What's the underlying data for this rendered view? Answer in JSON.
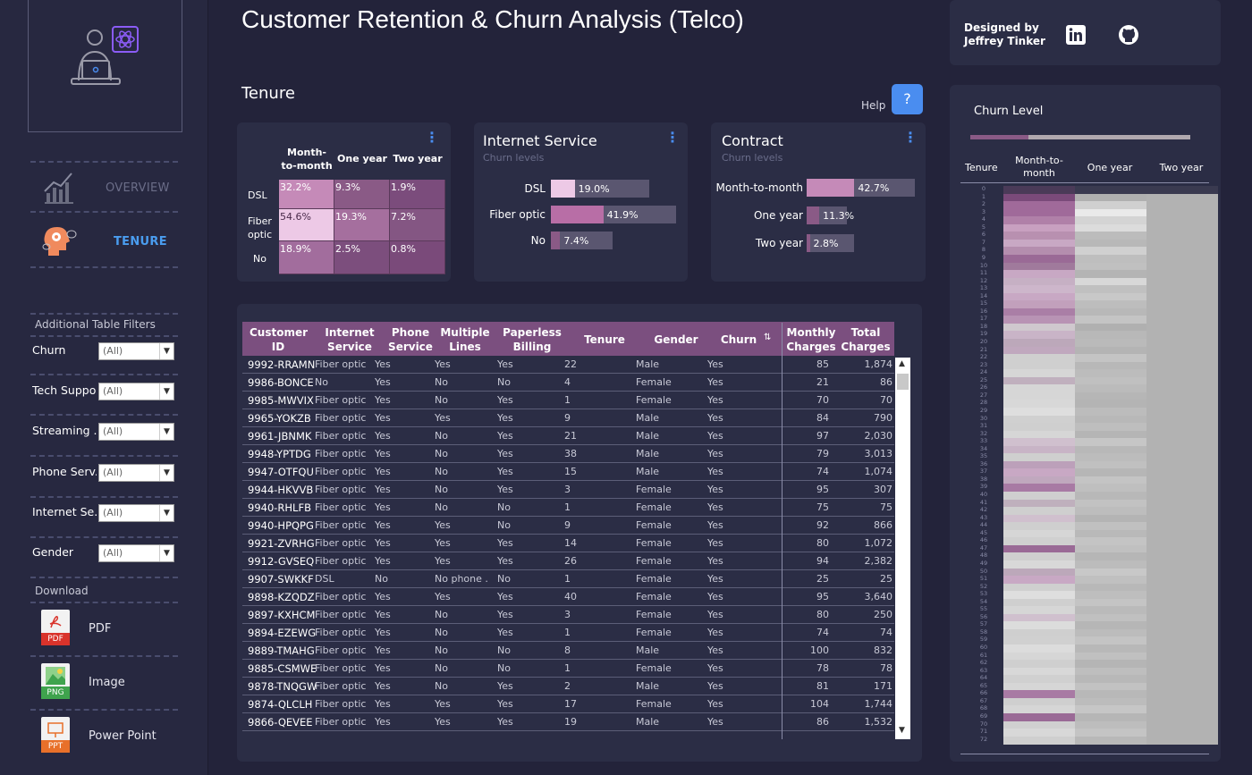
{
  "header": {
    "title": "Customer Retention & Churn Analysis (Telco)",
    "designed_by": "Designed by",
    "designer": "Jeffrey Tinker"
  },
  "sidebar": {
    "nav": [
      {
        "label": "OVERVIEW",
        "icon": "growth-chart-icon"
      },
      {
        "label": "TENURE",
        "icon": "head-gears-icon",
        "active": true
      }
    ],
    "filters_title": "Additional Table Filters",
    "filters": [
      {
        "label": "Churn",
        "value": "(All)"
      },
      {
        "label": "Tech Suppo..",
        "value": "(All)"
      },
      {
        "label": "Streaming ..",
        "value": "(All)"
      },
      {
        "label": "Phone Serv..",
        "value": "(All)"
      },
      {
        "label": "Internet Se..",
        "value": "(All)"
      },
      {
        "label": "Gender",
        "value": "(All)"
      }
    ],
    "download_title": "Download",
    "downloads": [
      {
        "label": "PDF",
        "tag": "PDF",
        "color": "#d9332b"
      },
      {
        "label": "Image",
        "tag": "PNG",
        "color": "#3fa34d"
      },
      {
        "label": "Power Point",
        "tag": "PPT",
        "color": "#e8702a"
      }
    ]
  },
  "section_title": "Tenure",
  "help_label": "Help",
  "help_button": "?",
  "heatmap": {
    "columns": [
      "Month-to-month",
      "One year",
      "Two year"
    ],
    "rows": [
      {
        "label": "DSL",
        "values": [
          "32.2%",
          "9.3%",
          "1.9%"
        ],
        "colors": [
          "#c58ab8",
          "#8a5a86",
          "#7b4c7c"
        ]
      },
      {
        "label": "Fiber optic",
        "values": [
          "54.6%",
          "19.3%",
          "7.2%"
        ],
        "colors": [
          "#edc9e6",
          "#a56f9e",
          "#845683"
        ]
      },
      {
        "label": "No",
        "values": [
          "18.9%",
          "2.5%",
          "0.8%"
        ],
        "colors": [
          "#a26d9d",
          "#7c4e7d",
          "#7a4a7a"
        ]
      }
    ]
  },
  "internet_service": {
    "title": "Internet Service",
    "subtitle": "Churn levels",
    "rows": [
      {
        "label": "DSL",
        "value": "19.0%",
        "frac": 0.19
      },
      {
        "label": "Fiber optic",
        "value": "41.9%",
        "frac": 0.419
      },
      {
        "label": "No",
        "value": "7.4%",
        "frac": 0.074
      }
    ]
  },
  "contract": {
    "title": "Contract",
    "subtitle": "Churn levels",
    "rows": [
      {
        "label": "Month-to-month",
        "value": "42.7%",
        "frac": 0.427
      },
      {
        "label": "One year",
        "value": "11.3%",
        "frac": 0.113
      },
      {
        "label": "Two year",
        "value": "2.8%",
        "frac": 0.028
      }
    ]
  },
  "table": {
    "columns": [
      "Customer ID",
      "Internet Service",
      "Phone Service",
      "Multiple Lines",
      "Paperless Billing",
      "Tenure",
      "Gender",
      "Churn",
      "Monthly Charges",
      "Total Charges"
    ],
    "rows": [
      [
        "9992-RRAMN",
        "Fiber optic",
        "Yes",
        "Yes",
        "Yes",
        "22",
        "Male",
        "Yes",
        "85",
        "1,874"
      ],
      [
        "9986-BONCE",
        "No",
        "Yes",
        "No",
        "No",
        "4",
        "Female",
        "Yes",
        "21",
        "86"
      ],
      [
        "9985-MWVIX",
        "Fiber optic",
        "Yes",
        "No",
        "Yes",
        "1",
        "Female",
        "Yes",
        "70",
        "70"
      ],
      [
        "9965-YOKZB",
        "Fiber optic",
        "Yes",
        "Yes",
        "Yes",
        "9",
        "Male",
        "Yes",
        "84",
        "790"
      ],
      [
        "9961-JBNMK",
        "Fiber optic",
        "Yes",
        "No",
        "Yes",
        "21",
        "Male",
        "Yes",
        "97",
        "2,030"
      ],
      [
        "9948-YPTDG",
        "Fiber optic",
        "Yes",
        "No",
        "Yes",
        "38",
        "Male",
        "Yes",
        "79",
        "3,013"
      ],
      [
        "9947-OTFQU",
        "Fiber optic",
        "Yes",
        "No",
        "Yes",
        "15",
        "Male",
        "Yes",
        "74",
        "1,074"
      ],
      [
        "9944-HKVVB",
        "Fiber optic",
        "Yes",
        "No",
        "Yes",
        "3",
        "Female",
        "Yes",
        "95",
        "307"
      ],
      [
        "9940-RHLFB",
        "Fiber optic",
        "Yes",
        "No",
        "No",
        "1",
        "Female",
        "Yes",
        "75",
        "75"
      ],
      [
        "9940-HPQPG",
        "Fiber optic",
        "Yes",
        "Yes",
        "No",
        "9",
        "Female",
        "Yes",
        "92",
        "866"
      ],
      [
        "9921-ZVRHG",
        "Fiber optic",
        "Yes",
        "Yes",
        "Yes",
        "14",
        "Female",
        "Yes",
        "80",
        "1,072"
      ],
      [
        "9912-GVSEQ",
        "Fiber optic",
        "Yes",
        "Yes",
        "Yes",
        "26",
        "Female",
        "Yes",
        "94",
        "2,382"
      ],
      [
        "9907-SWKKF",
        "DSL",
        "No",
        "No phone ..",
        "No",
        "1",
        "Female",
        "Yes",
        "25",
        "25"
      ],
      [
        "9898-KZQDZ",
        "Fiber optic",
        "Yes",
        "Yes",
        "Yes",
        "40",
        "Female",
        "Yes",
        "95",
        "3,640"
      ],
      [
        "9897-KXHCM",
        "Fiber optic",
        "Yes",
        "No",
        "Yes",
        "3",
        "Female",
        "Yes",
        "80",
        "250"
      ],
      [
        "9894-EZEWG",
        "Fiber optic",
        "Yes",
        "No",
        "Yes",
        "1",
        "Female",
        "Yes",
        "74",
        "74"
      ],
      [
        "9889-TMAHG",
        "Fiber optic",
        "Yes",
        "No",
        "No",
        "8",
        "Male",
        "Yes",
        "100",
        "832"
      ],
      [
        "9885-CSMWE",
        "Fiber optic",
        "Yes",
        "No",
        "No",
        "1",
        "Female",
        "Yes",
        "78",
        "78"
      ],
      [
        "9878-TNQGW",
        "Fiber optic",
        "Yes",
        "No",
        "Yes",
        "2",
        "Male",
        "Yes",
        "81",
        "171"
      ],
      [
        "9874-QLCLH",
        "Fiber optic",
        "Yes",
        "Yes",
        "Yes",
        "17",
        "Female",
        "Yes",
        "104",
        "1,744"
      ],
      [
        "9866-QEVEE",
        "Fiber optic",
        "Yes",
        "Yes",
        "Yes",
        "19",
        "Male",
        "Yes",
        "86",
        "1,532"
      ]
    ]
  },
  "churn_level": {
    "title": "Churn Level",
    "columns": [
      "Tenure",
      "Month-to-month",
      "One year",
      "Two year"
    ],
    "tenure_max": 72
  }
}
